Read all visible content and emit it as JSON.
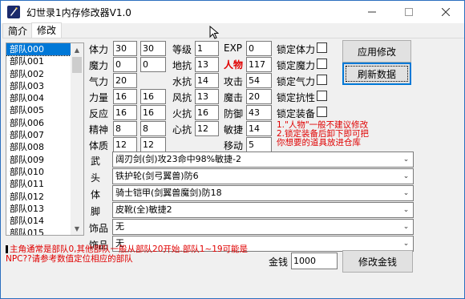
{
  "window": {
    "title": "幻世录1内存修改器V1.0"
  },
  "tabs": [
    {
      "label": "简介",
      "active": false
    },
    {
      "label": "修改",
      "active": true
    }
  ],
  "unit_list": {
    "items": [
      "部队000",
      "部队001",
      "部队002",
      "部队003",
      "部队004",
      "部队005",
      "部队006",
      "部队007",
      "部队008",
      "部队009",
      "部队010",
      "部队011",
      "部队012",
      "部队013",
      "部队014",
      "部队015"
    ],
    "selected": "部队000"
  },
  "stats": {
    "tili": {
      "label": "体力",
      "v1": "30",
      "v2": "30"
    },
    "moli": {
      "label": "魔力",
      "v1": "0",
      "v2": "0"
    },
    "qili": {
      "label": "气力",
      "v1": "20"
    },
    "liliang": {
      "label": "力量",
      "v1": "16",
      "v2": "16"
    },
    "fanying": {
      "label": "反应",
      "v1": "16",
      "v2": "16"
    },
    "jingshen": {
      "label": "精神",
      "v1": "8",
      "v2": "8"
    },
    "tizhi": {
      "label": "体质",
      "v1": "12",
      "v2": "12"
    },
    "dengji": {
      "label": "等级",
      "v": "1"
    },
    "dikang": {
      "label": "地抗",
      "v": "13"
    },
    "shuikang": {
      "label": "水抗",
      "v": "14"
    },
    "fengkang": {
      "label": "风抗",
      "v": "13"
    },
    "huokang": {
      "label": "火抗",
      "v": "16"
    },
    "xinkang": {
      "label": "心抗",
      "v": "12"
    },
    "exp": {
      "label": "EXP",
      "v": "0"
    },
    "renwu": {
      "label": "人物",
      "v": "117"
    },
    "gongji": {
      "label": "攻击",
      "v": "54"
    },
    "moji": {
      "label": "魔击",
      "v": "20"
    },
    "fangyu": {
      "label": "防御",
      "v": "43"
    },
    "minjie": {
      "label": "敏捷",
      "v": "14"
    },
    "yidong": {
      "label": "移动",
      "v": "5"
    }
  },
  "locks": [
    {
      "label": "锁定体力"
    },
    {
      "label": "锁定魔力"
    },
    {
      "label": "锁定气力"
    },
    {
      "label": "锁定抗性"
    },
    {
      "label": "锁定装备"
    }
  ],
  "buttons": {
    "apply": "应用修改",
    "refresh": "刷新数据",
    "money": "修改金钱"
  },
  "notes": {
    "line1": "1.\"人物\"一般不建议修改",
    "line2": "2.锁定装备后卸下即可把",
    "line3": "你想要的道具放进仓库"
  },
  "equipment": [
    {
      "label": "武",
      "value": "阔刃剑(剑)攻23命中98%敏捷-2"
    },
    {
      "label": "头",
      "value": "铁护轮(剑弓翼兽)防6"
    },
    {
      "label": "体",
      "value": "骑士铠甲(剑翼兽魔剑)防18"
    },
    {
      "label": "脚",
      "value": "皮靴(全)敏捷2"
    },
    {
      "label": "饰品",
      "value": "无"
    },
    {
      "label": "饰品",
      "value": "无"
    }
  ],
  "money": {
    "label": "金钱",
    "value": "1000"
  },
  "bottom_note": {
    "line1": "主角通常是部队0,其他部队一般从部队20开始.部队1~19可能是",
    "line2": "NPC??请参考数值定位相应的部队"
  }
}
